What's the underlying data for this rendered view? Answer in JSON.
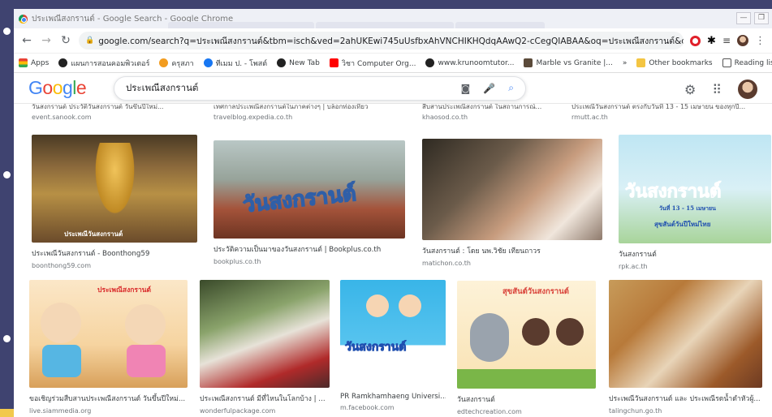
{
  "window": {
    "title": "ประเพณีสงกรานต์ - Google Search - Google Chrome"
  },
  "address": {
    "url": "google.com/search?q=ประเพณีสงกรานต์&tbm=isch&ved=2ahUKEwi745uUsfbxAhVNCHIKHQdqAAwQ2-cCegQIABAA&oq=ประเพณีสงกรานต์&gs_lcp=C..."
  },
  "bookmarks": {
    "items": [
      "Apps",
      "แผนการสอนคอมพิวเตอร์",
      "ครุสภา",
      "ทีเมม ป. - โพสต์",
      "New Tab",
      "วิชา Computer Org...",
      "www.krunoomtutor...",
      "Marble vs Granite |..."
    ],
    "more": "»",
    "other": "Other bookmarks",
    "reading": "Reading list"
  },
  "google": {
    "logo": [
      "G",
      "o",
      "o",
      "g",
      "l",
      "e"
    ],
    "query": "ประเพณีสงกรานต์"
  },
  "top_row": [
    {
      "title": "วันสงกรานต์ ประวัติวันสงกรานต์ วันขึ้นปีใหม่...",
      "source": "event.sanook.com"
    },
    {
      "title": "เทศกาลประเพณีสงกรานต์ในภาคต่างๆ | บล็อกท่องเที่ยว",
      "source": "travelblog.expedia.co.th"
    },
    {
      "title": "สืบสานประเพณีสงกรานต์ ในสถานการณ์...",
      "source": "khaosod.co.th"
    },
    {
      "title": "ประเพณีวันสงกรานต์ ตรงกับวันที่ 13 - 15 เมษายน ของทุกปี...",
      "source": "rmutt.ac.th"
    }
  ],
  "row2": [
    {
      "title": "ประเพณีวันสงกรานต์ - Boonthong59",
      "source": "boonthong59.com"
    },
    {
      "title": "ประวัติความเป็นมาของวันสงกรานต์ | Bookplus.co.th",
      "source": "bookplus.co.th"
    },
    {
      "title": "วันสงกรานต์ : โดย นพ.วิชัย เทียนถาวร",
      "source": "matichon.co.th"
    },
    {
      "title": "วันสงกรานต์",
      "source": "rpk.ac.th"
    }
  ],
  "row3": [
    {
      "title": "ขอเชิญร่วมสืบสานประเพณีสงกรานต์ วันขึ้นปีใหม่...",
      "source": "live.siammedia.org"
    },
    {
      "title": "ประเพณีสงกรานต์ มีที่ไหนในโลกบ้าง | ...",
      "source": "wonderfulpackage.com"
    },
    {
      "title": "PR Ramkhamhaeng Universi...",
      "source": "m.facebook.com"
    },
    {
      "title": "วันสงกรานต์",
      "source": "edtechcreation.com"
    },
    {
      "title": "ประเพณีวันสงกรานต์ และ ประเพณีรดน้ำดำหัวผู้...",
      "source": "talingchun.go.th"
    }
  ],
  "overlays": {
    "bookplus": "วันสงกรานต์",
    "rpk": "วันสงกรานต์",
    "rpk_date": "วันที่ 13 - 15 เมษายน",
    "rpk_sub": "สุขสันต์วันปีใหม่ไทย",
    "siammedia": "ประเพณีสงกรานต์",
    "facebook": "วันสงกรานต์",
    "edtech": "สุขสันต์วันสงกรานต์",
    "boonthong": "ประเพณีวันสงกรานต์"
  },
  "colors": {
    "g_blue": "#4285f4",
    "g_red": "#ea4335",
    "g_yellow": "#fbbc05",
    "g_green": "#34a853",
    "link_gray": "#70757a"
  }
}
